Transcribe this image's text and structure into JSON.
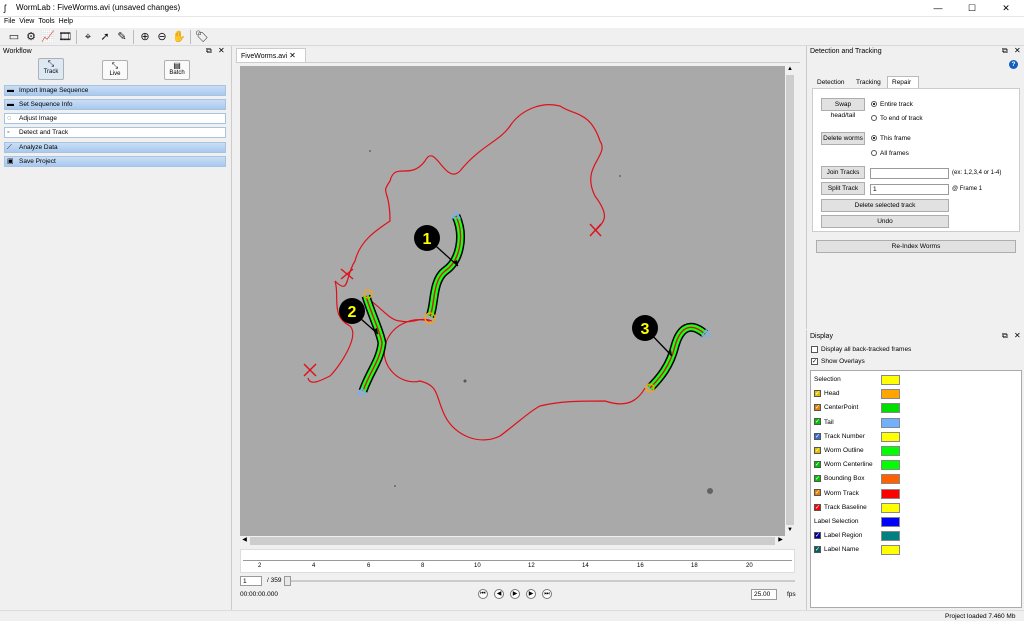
{
  "window": {
    "title": "WormLab : FiveWorms.avi (unsaved changes)",
    "min": "—",
    "max": "☐",
    "close": "✕"
  },
  "menu": [
    "File",
    "View",
    "Tools",
    "Help"
  ],
  "workflow": {
    "title": "Workflow",
    "tabs": [
      "Track",
      "Live",
      "Batch"
    ],
    "steps": [
      "Import Image Sequence",
      "Set Sequence Info",
      "Adjust Image",
      "Detect and Track",
      "Analyze Data",
      "Save Project"
    ]
  },
  "document": {
    "tab": "FiveWorms.avi",
    "close": "✕"
  },
  "timeline": {
    "ticks": [
      "2",
      "4",
      "6",
      "8",
      "10",
      "12",
      "14",
      "16",
      "18",
      "20"
    ],
    "frame": "1",
    "total": "/ 359",
    "time": "00:00:00.000",
    "fps": "25.00",
    "fps_unit": "fps"
  },
  "detection": {
    "title": "Detection and Tracking",
    "tabs": [
      "Detection",
      "Tracking",
      "Repair"
    ],
    "swap_btn": "Swap head/tail",
    "entire_track": "Entire track",
    "to_end": "To end of track",
    "delete_btn": "Delete worms",
    "this_frame": "This frame",
    "all_frames": "All frames",
    "join_btn": "Join Tracks",
    "join_hint": "(ex: 1,2,3,4 or 1-4)",
    "split_btn": "Split Track",
    "split_value": "1",
    "split_frame": "@ Frame 1",
    "delete_track": "Delete selected track",
    "undo": "Undo",
    "reindex": "Re-Index Worms"
  },
  "display": {
    "title": "Display",
    "show_back": "Display all back-tracked frames",
    "show_overlays": "Show Overlays",
    "items": [
      {
        "label": "Selection",
        "color": "#ffff00",
        "check": "none"
      },
      {
        "label": "Head",
        "color": "#ffa500",
        "check": "#e0c000"
      },
      {
        "label": "CenterPoint",
        "color": "#00e000",
        "check": "#e08000"
      },
      {
        "label": "Tail",
        "color": "#70b0ff",
        "check": "#00c000"
      },
      {
        "label": "Track Number",
        "color": "#ffff00",
        "check": "#3070d0"
      },
      {
        "label": "Worm Outline",
        "color": "#00ff00",
        "check": "#e0c000"
      },
      {
        "label": "Worm Centerline",
        "color": "#00ff00",
        "check": "#00c000"
      },
      {
        "label": "Bounding Box",
        "color": "#ff6000",
        "check": "#00c000"
      },
      {
        "label": "Worm Track",
        "color": "#ff0000",
        "check": "#e08000"
      },
      {
        "label": "Track Baseline",
        "color": "#ffff00",
        "check": "#ff0000"
      },
      {
        "label": "Label Selection",
        "color": "#0000ff",
        "check": "none"
      },
      {
        "label": "Label Region",
        "color": "#008080",
        "check": "#0000a0"
      },
      {
        "label": "Label Name",
        "color": "#ffff00",
        "check": "#006060"
      }
    ]
  },
  "worms": [
    "1",
    "2",
    "3"
  ],
  "status": "Project loaded 7.460 Mb",
  "colors": {
    "track": "#e0101a",
    "outline": "#19ff19",
    "bg": "#a9a9a9"
  }
}
